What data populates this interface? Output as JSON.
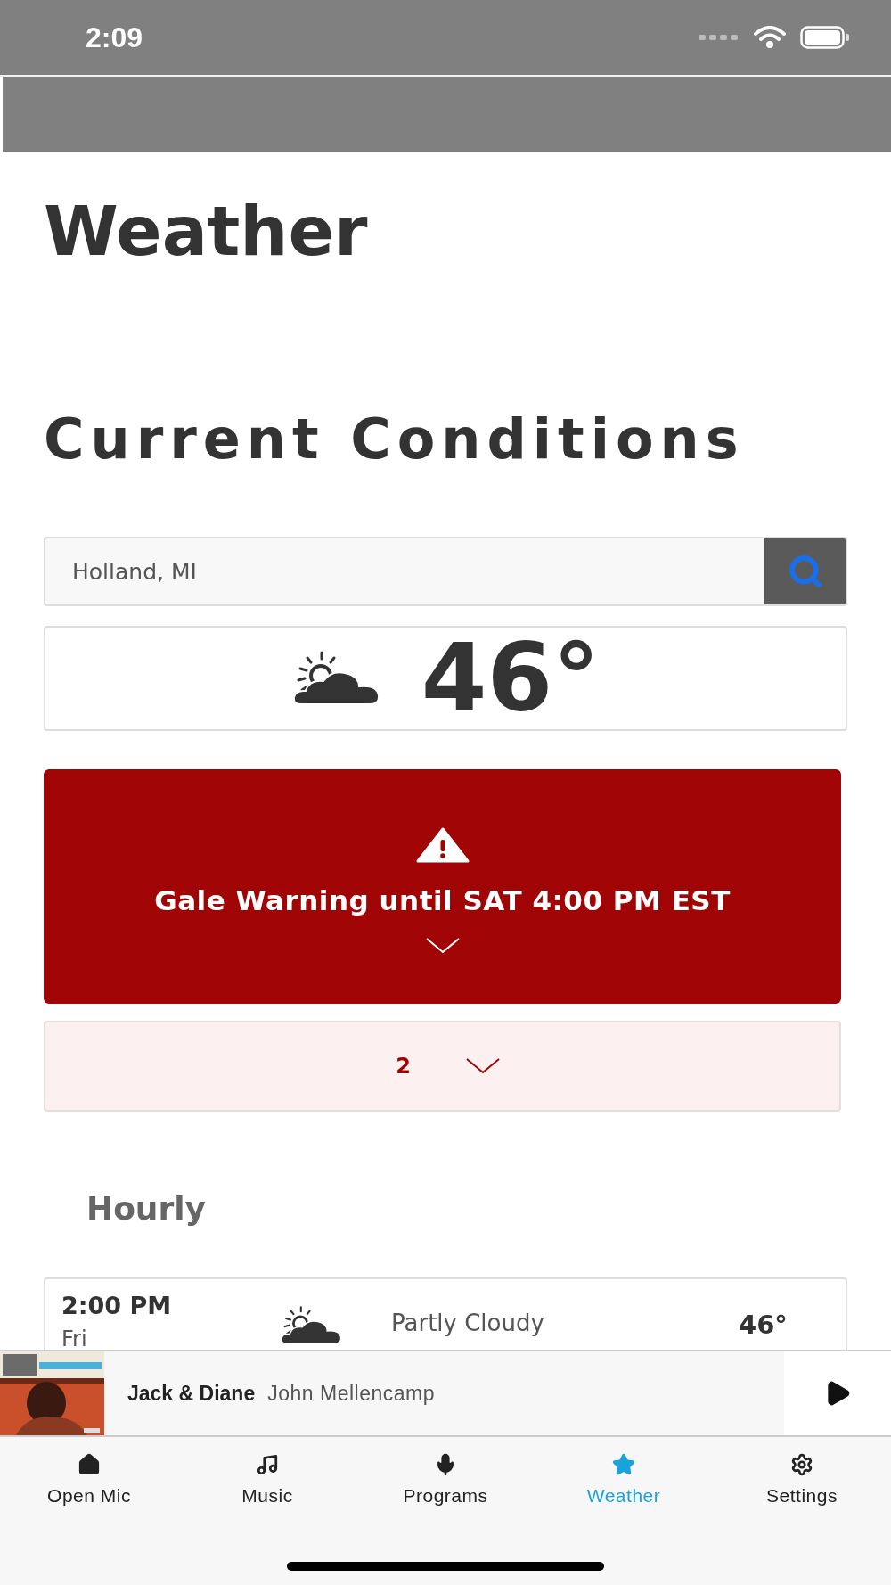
{
  "status_bar": {
    "time": "2:09"
  },
  "page_title": "Weather",
  "section_title": "Current Conditions",
  "search": {
    "value": "Holland, MI"
  },
  "current": {
    "temperature": "46°"
  },
  "alert": {
    "text": "Gale Warning until SAT 4:00 PM EST",
    "expanded": false
  },
  "more_alerts": {
    "count": "2",
    "expanded": false
  },
  "hourly": {
    "title": "Hourly",
    "rows": [
      {
        "time": "2:00 PM",
        "day": "Fri",
        "condition": "Partly Cloudy",
        "temperature": "46°"
      }
    ]
  },
  "now_playing": {
    "title": "Jack & Diane",
    "artist": "John Mellencamp",
    "playing": false
  },
  "tabs": [
    {
      "label": "Open Mic",
      "kind": "home",
      "selected": false
    },
    {
      "label": "Music",
      "kind": "music",
      "selected": false
    },
    {
      "label": "Programs",
      "kind": "mic",
      "selected": false
    },
    {
      "label": "Weather",
      "kind": "star",
      "selected": true
    },
    {
      "label": "Settings",
      "kind": "gear",
      "selected": false
    }
  ]
}
